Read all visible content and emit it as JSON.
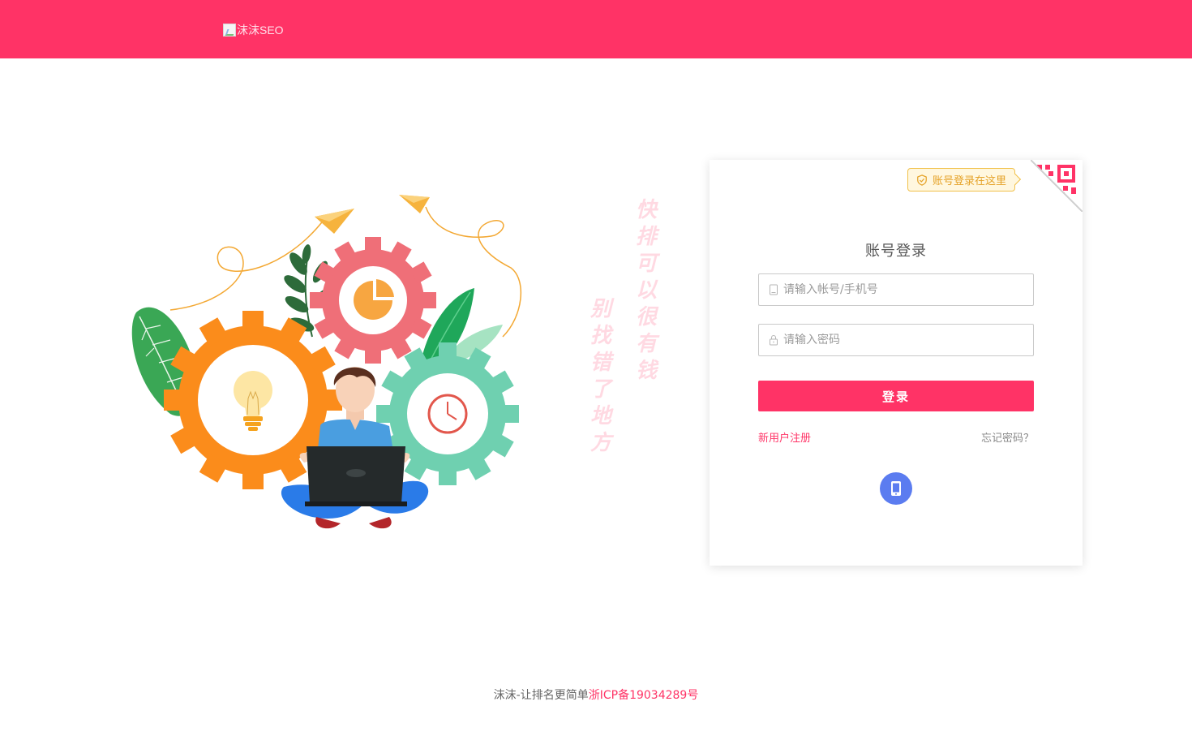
{
  "header": {
    "logo_alt": "沫沫SEO",
    "brand_color": "#ff3366"
  },
  "illustration": {
    "icons": [
      "gear-icon",
      "lightbulb-icon",
      "pie-chart-icon",
      "clock-icon",
      "paper-plane-icon",
      "laptop-icon",
      "leaf-icon"
    ]
  },
  "slogan": {
    "line1": "快排可以很有钱",
    "line2": "别找错了地方"
  },
  "login": {
    "tip": "账号登录在这里",
    "title": "账号登录",
    "username_placeholder": "请输入帐号/手机号",
    "password_placeholder": "请输入密码",
    "submit_label": "登录",
    "register_link": "新用户注册",
    "forgot_link": "忘记密码？",
    "alt_login_icon": "phone-icon",
    "qr_icon": "qr-code-icon"
  },
  "footer": {
    "text": "沫沫-让排名更简单",
    "icp": "浙ICP备19034289号"
  }
}
